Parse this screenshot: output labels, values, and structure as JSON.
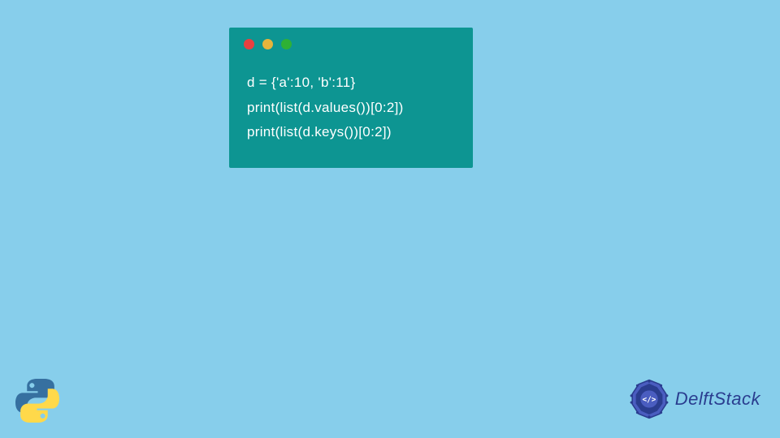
{
  "code": {
    "lines": [
      "d = {'a':10, 'b':11}",
      "print(list(d.values())[0:2])",
      "print(list(d.keys())[0:2])"
    ]
  },
  "branding": {
    "delftstack_text": "DelftStack"
  }
}
